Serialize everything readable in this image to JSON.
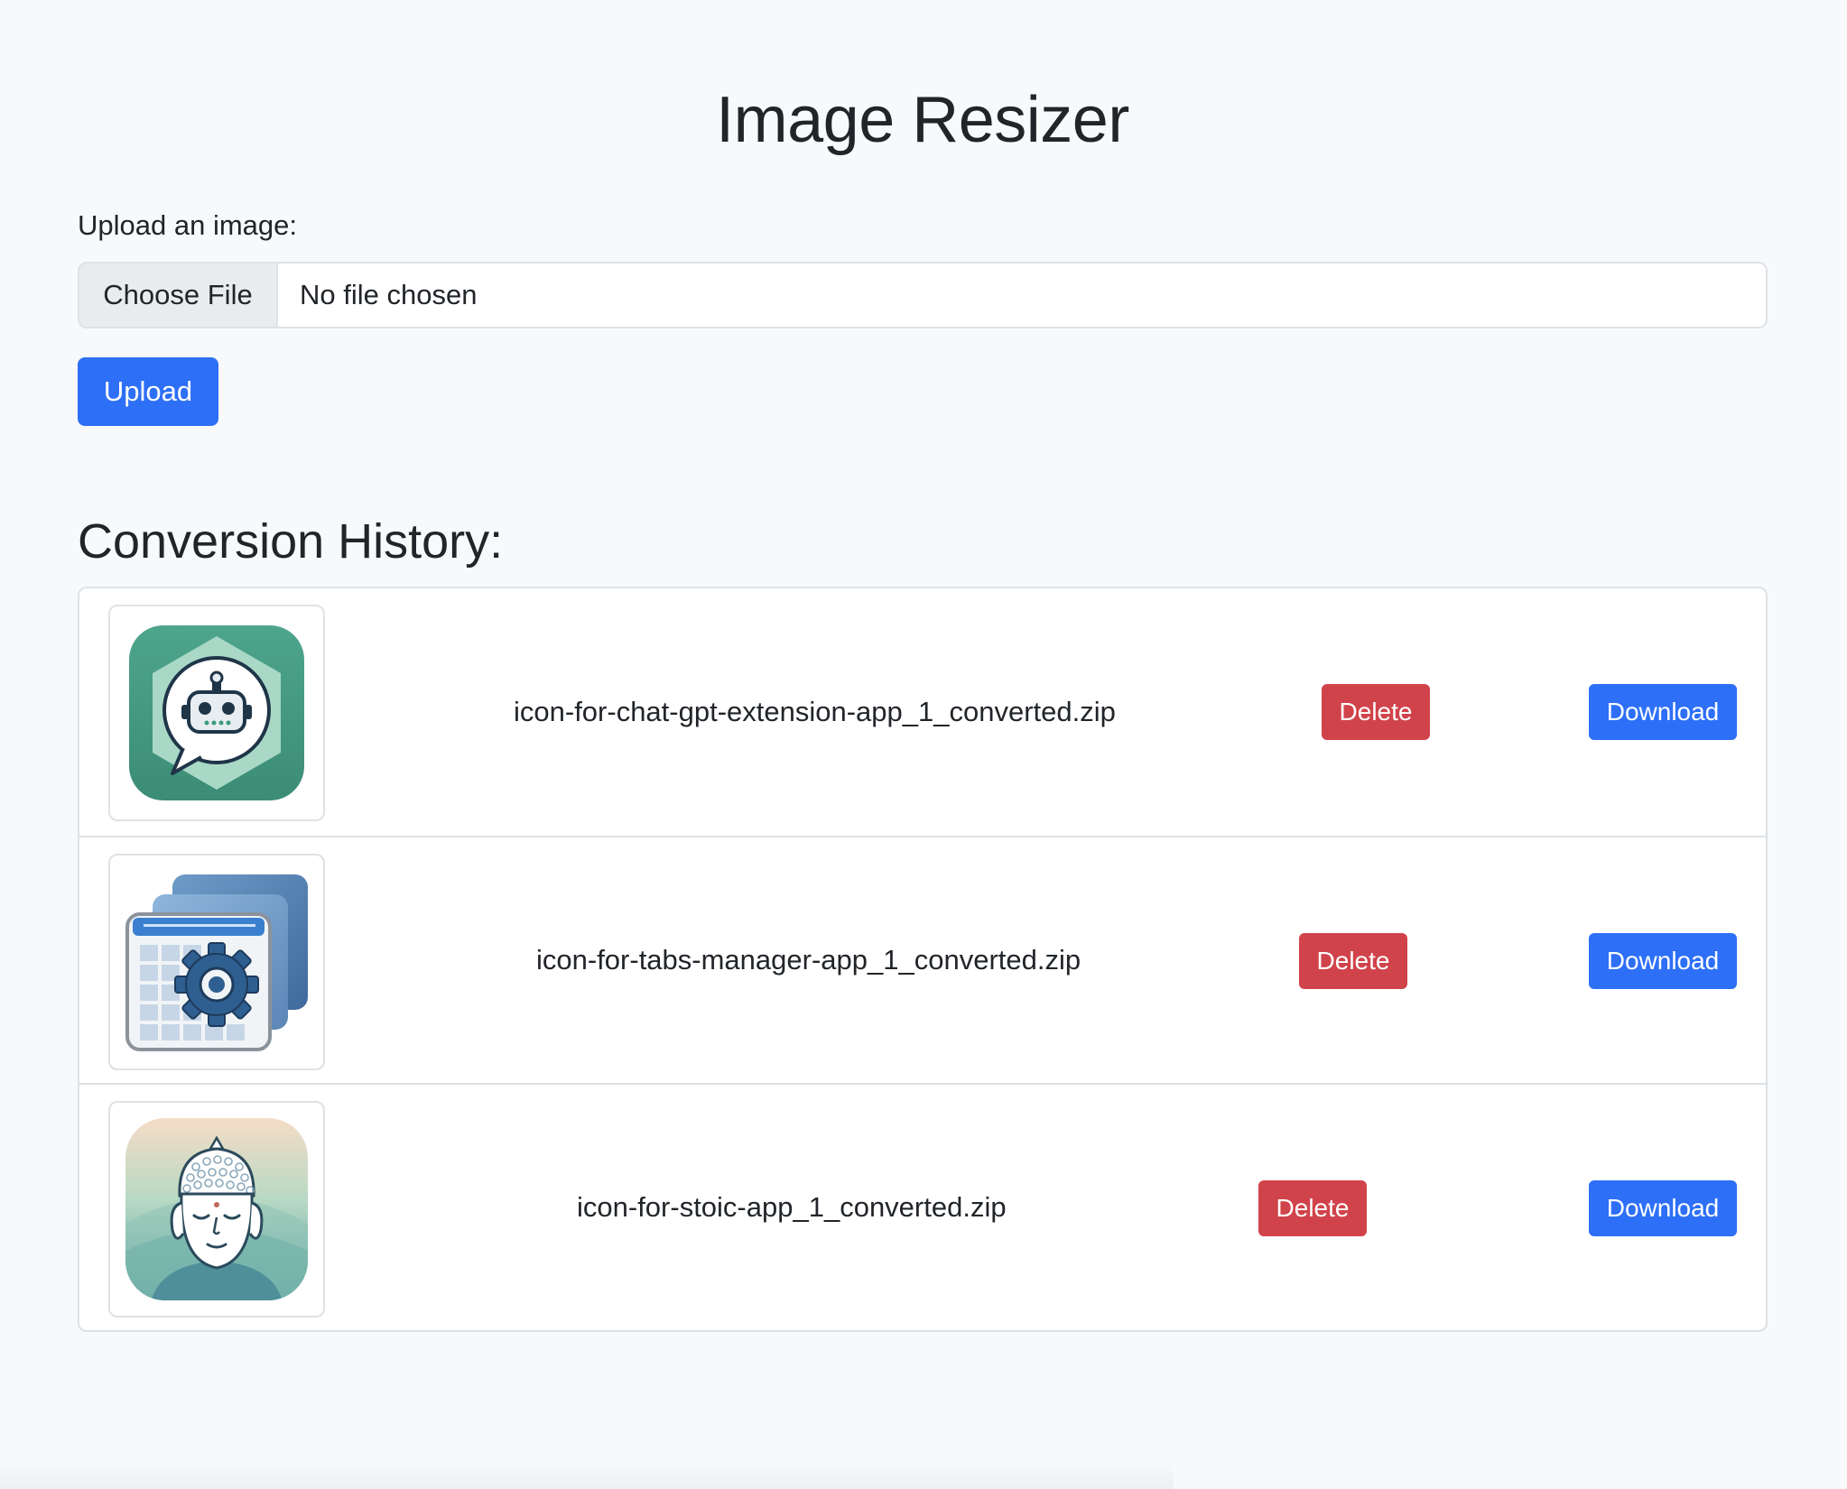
{
  "header": {
    "title": "Image Resizer"
  },
  "upload": {
    "label": "Upload an image:",
    "choose_file_label": "Choose File",
    "file_status": "No file chosen",
    "upload_button": "Upload"
  },
  "history": {
    "title": "Conversion History:",
    "items": [
      {
        "filename": "icon-for-chat-gpt-extension-app_1_converted.zip",
        "icon": "chat-bot-icon",
        "delete_label": "Delete",
        "download_label": "Download"
      },
      {
        "filename": "icon-for-tabs-manager-app_1_converted.zip",
        "icon": "tabs-manager-gear-icon",
        "delete_label": "Delete",
        "download_label": "Download"
      },
      {
        "filename": "icon-for-stoic-app_1_converted.zip",
        "icon": "buddha-face-icon",
        "delete_label": "Delete",
        "download_label": "Download"
      }
    ]
  },
  "colors": {
    "primary": "#2d6ff7",
    "danger": "#d1434b",
    "background": "#f8f9fa",
    "border": "#dee2e6"
  }
}
